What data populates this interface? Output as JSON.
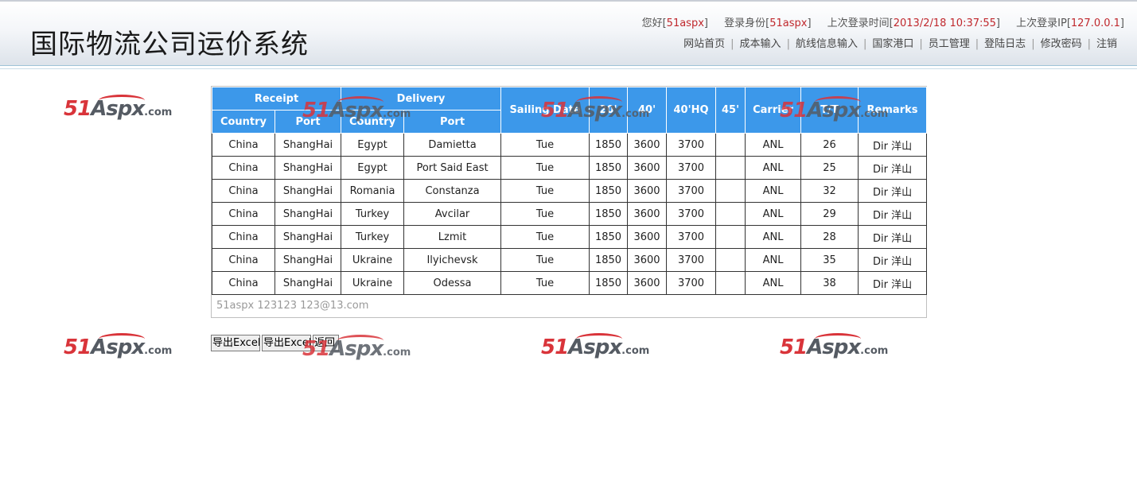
{
  "header": {
    "title": "国际物流公司运价系统",
    "greeting_prefix": "您好[",
    "username": "51aspx",
    "greeting_suffix": "]",
    "role_prefix": "登录身份[",
    "role": "51aspx",
    "role_suffix": "]",
    "lastlogin_prefix": "上次登录时间[",
    "lastlogin": "2013/2/18 10:37:55",
    "lastlogin_suffix": "]",
    "lastip_prefix": "上次登录IP[",
    "lastip": "127.0.0.1",
    "lastip_suffix": "]"
  },
  "nav": [
    "网站首页",
    "成本输入",
    "航线信息输入",
    "国家港口",
    "员工管理",
    "登陆日志",
    "修改密码",
    "注销"
  ],
  "table": {
    "group_receipt": "Receipt",
    "group_delivery": "Delivery",
    "headers": {
      "country": "Country",
      "port": "Port",
      "sailing": "Sailing Date",
      "c20": "20'",
      "c40": "40'",
      "c40hq": "40'HQ",
      "c45": "45'",
      "carrier": "Carrier",
      "tt": "T/T",
      "remarks": "Remarks"
    },
    "rows": [
      [
        "China",
        "ShangHai",
        "Egypt",
        "Damietta",
        "Tue",
        "1850",
        "3600",
        "3700",
        "",
        "ANL",
        "26",
        "Dir 洋山"
      ],
      [
        "China",
        "ShangHai",
        "Egypt",
        "Port Said East",
        "Tue",
        "1850",
        "3600",
        "3700",
        "",
        "ANL",
        "25",
        "Dir 洋山"
      ],
      [
        "China",
        "ShangHai",
        "Romania",
        "Constanza",
        "Tue",
        "1850",
        "3600",
        "3700",
        "",
        "ANL",
        "32",
        "Dir 洋山"
      ],
      [
        "China",
        "ShangHai",
        "Turkey",
        "Avcilar",
        "Tue",
        "1850",
        "3600",
        "3700",
        "",
        "ANL",
        "29",
        "Dir 洋山"
      ],
      [
        "China",
        "ShangHai",
        "Turkey",
        "Lzmit",
        "Tue",
        "1850",
        "3600",
        "3700",
        "",
        "ANL",
        "28",
        "Dir 洋山"
      ],
      [
        "China",
        "ShangHai",
        "Ukraine",
        "Ilyichevsk",
        "Tue",
        "1850",
        "3600",
        "3700",
        "",
        "ANL",
        "35",
        "Dir 洋山"
      ],
      [
        "China",
        "ShangHai",
        "Ukraine",
        "Odessa",
        "Tue",
        "1850",
        "3600",
        "3700",
        "",
        "ANL",
        "38",
        "Dir 洋山"
      ]
    ],
    "footer": "51aspx 123123 123@13.com"
  },
  "buttons": {
    "export1": "导出Excel",
    "export2": "导出Excel",
    "back": "返回"
  },
  "watermark": {
    "num": "51",
    "brand": "Aspx",
    "suffix": ".com"
  },
  "colors": {
    "header_bg": "#3c98ea",
    "highlight": "#c0282d",
    "watermark_red": "#d9343a"
  }
}
